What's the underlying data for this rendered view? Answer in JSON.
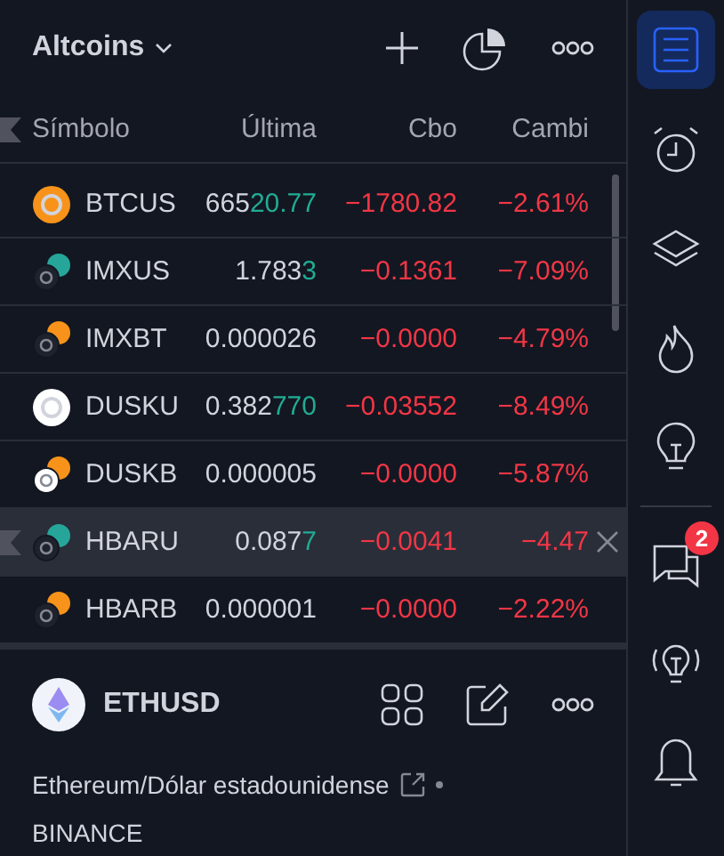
{
  "watchlist": {
    "title": "Altcoins"
  },
  "columns": [
    {
      "label": "Símbolo"
    },
    {
      "label": "Última"
    },
    {
      "label": "Cbo"
    },
    {
      "label": "Cambi"
    }
  ],
  "rows": [
    {
      "symbol": "BTCUS",
      "logo": [
        {
          "color": "#f7931a"
        }
      ],
      "last_base": "665",
      "last_changed": "20.77",
      "change": "−1780.82",
      "change_pct": "−2.61%",
      "selected": false
    },
    {
      "symbol": "IMXUS",
      "logo": [
        {
          "color": "#1e222d"
        },
        {
          "color": "#26a69a"
        }
      ],
      "last_base": "1.783",
      "last_changed": "3",
      "change": "−0.1361",
      "change_pct": "−7.09%",
      "selected": false
    },
    {
      "symbol": "IMXBT",
      "logo": [
        {
          "color": "#1e222d"
        },
        {
          "color": "#f7931a"
        }
      ],
      "last_base": "0.000026",
      "change": "−0.0000",
      "change_pct": "−4.79%",
      "selected": false
    },
    {
      "symbol": "DUSKU",
      "logo": [
        {
          "color": "#ffffff"
        }
      ],
      "last_base": "0.382",
      "last_changed": "770",
      "change": "−0.03552",
      "change_pct": "−8.49%",
      "selected": false
    },
    {
      "symbol": "DUSKB",
      "logo": [
        {
          "color": "#ffffff"
        },
        {
          "color": "#f7931a"
        }
      ],
      "last_base": "0.000005",
      "change": "−0.0000",
      "change_pct": "−5.87%",
      "selected": false
    },
    {
      "symbol": "HBARU",
      "logo": [
        {
          "color": "#1e222d"
        },
        {
          "color": "#26a69a"
        }
      ],
      "last_base": "0.087",
      "last_changed": "7",
      "change": "−0.0041",
      "change_pct": "−4.47",
      "selected": true
    },
    {
      "symbol": "HBARB",
      "logo": [
        {
          "color": "#1e222d"
        },
        {
          "color": "#f7931a"
        }
      ],
      "last_base": "0.000001",
      "change": "−0.0000",
      "change_pct": "−2.22%",
      "selected": false
    }
  ],
  "details": {
    "symbol": "ETHUSD",
    "description": "Ethereum/Dólar estadounidense",
    "exchange": "BINANCE"
  },
  "sidebar_top": [
    {
      "kind": "watchlist",
      "selected": true
    },
    {
      "kind": "alarm",
      "selected": false
    },
    {
      "kind": "layers",
      "selected": false
    },
    {
      "kind": "flame",
      "selected": false
    },
    {
      "kind": "bulb",
      "selected": false
    }
  ],
  "sidebar_bottom": [
    {
      "kind": "chat",
      "selected": false,
      "badge": "2"
    },
    {
      "kind": "bulb-signal",
      "selected": false
    },
    {
      "kind": "bell",
      "selected": false
    }
  ]
}
